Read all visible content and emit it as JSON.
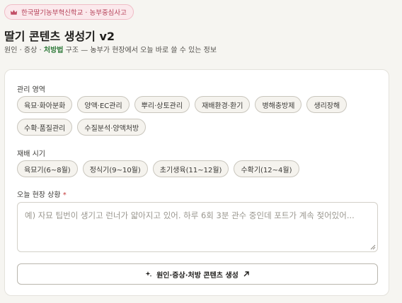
{
  "header": {
    "badge": "한국딸기농부혁신학교 · 농부중심사고",
    "title": "딸기 콘텐츠 생성기 v2",
    "subtitle_prefix": "원인 · 증상 · ",
    "subtitle_highlight": "처방법",
    "subtitle_suffix": " 구조 — 농부가 현장에서 오늘 바로 쓸 수 있는 정보"
  },
  "form": {
    "area_label": "관리 영역",
    "areas": [
      "육묘·화아분화",
      "양액·EC관리",
      "뿌리·상토관리",
      "재배환경·환기",
      "병해충방제",
      "생리장해",
      "수확·품질관리",
      "수질분석·양액처방"
    ],
    "season_label": "재배 시기",
    "seasons": [
      "육묘기(6~8월)",
      "정식기(9~10월)",
      "초기생육(11~12월)",
      "수확기(12~4월)"
    ],
    "situation_label": "오늘 현장 상황",
    "required_mark": "*",
    "situation_placeholder": "예) 자묘 팁번이 생기고 런너가 얇아지고 있어. 하루 6회 3분 관수 중인데 포트가 계속 젖어있어...",
    "situation_value": "",
    "generate_label": "원인·증상·처방 콘텐츠 생성"
  },
  "colors": {
    "accent_green": "#2f7a3a",
    "badge_text": "#b53f57",
    "required": "#c43a3a"
  },
  "icons": {
    "badge": "crown-icon",
    "generate": "sparkle-icon",
    "generate_after": "arrow-up-right-icon"
  }
}
